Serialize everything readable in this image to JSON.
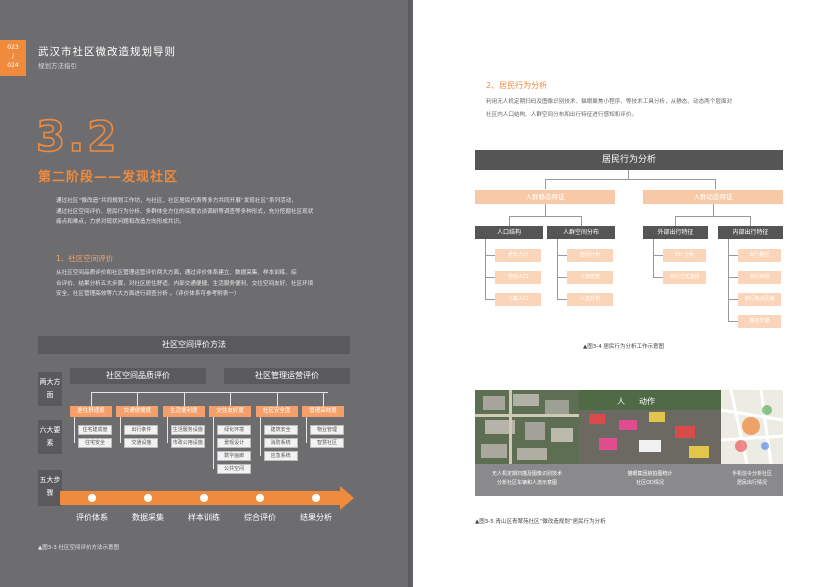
{
  "header": {
    "page_numbers": [
      "023",
      "/",
      "024"
    ],
    "title": "武汉市社区微改造规划导则",
    "subtitle": "规划方法指引"
  },
  "section": {
    "number": "3.2",
    "stage_title": "第二阶段——发现社区",
    "intro": [
      "通过社区“微改造”共同规划工作坊，与社区、社区居民代表等多方共同开展“发现社区”系列活动，",
      "通过社区空间评价、居民行为分析、多群体全方位的深度访谈调研等调查等多种形式，充分挖掘社区现状",
      "痛点和难点，力求对现状问题和改造方向形成共识。"
    ],
    "sub1_title": "1、社区空间评价",
    "sub1_text": [
      "从社区空间品质评价和社区管理运营评价两大方面，通过评价体系建立、数据采集、样本训练、综",
      "合评价、结果分析五大步骤，对社区居住舒适、内部交通便捷、生活服务便利、交往空间友好、社区环境",
      "安全、社区管理高效等六大方面进行调查分析 。（评价体系可参考附表一）"
    ]
  },
  "left_diagram": {
    "title": "社区空间评价方法",
    "row_labels": [
      "两大方面",
      "六大要素",
      "五大步骤"
    ],
    "aspects": [
      "社区空间品质评价",
      "社区管理运营评价"
    ],
    "elements": [
      "居住舒适度",
      "交通便捷度",
      "生活便利度",
      "交往友好度",
      "社区安全度",
      "管理高效度"
    ],
    "sub_items": [
      [
        "住宅建成度",
        "住宅安全"
      ],
      [
        "出行条件",
        "交通设施"
      ],
      [
        "生活服务设施",
        "市政公用设施"
      ],
      [
        "绿化环境",
        "景观设计",
        "数字画廊",
        "公共空间"
      ],
      [
        "建筑安全",
        "消防系统",
        "应急系统"
      ],
      [
        "物业管理",
        "智慧社区"
      ]
    ],
    "steps": [
      "评价体系",
      "数据采集",
      "样本训练",
      "综合评价",
      "结果分析"
    ],
    "caption": "▲图3-3 社区空间评价方法示意图"
  },
  "behavior": {
    "title": "2、居民行为分析",
    "text": [
      "利用无人机定期扫码及图像识别技术、猫眼聚焦小程序、等技术工具分析，从静态、动态两个层面对",
      "社区内人口结构、人群空间分布和出行特征进行感知和评价。"
    ],
    "diagram": {
      "root": "居民行为分析",
      "branches": [
        "人群静态特征",
        "人群动态特征"
      ],
      "groups": [
        "人口结构",
        "人群空间分布",
        "外部出行特征",
        "内部出行特征"
      ],
      "group_items": [
        [
          "老年人口",
          "劳动人口",
          "儿童人口"
        ],
        [
          "空间分布",
          "人流密度",
          "人流分布"
        ],
        [
          "OD 分析",
          "出行方式选择"
        ],
        [
          "出行路径",
          "出行目的",
          "出行热点区域",
          "静态交通"
        ]
      ],
      "caption": "▲图3-4 居民行为分析工作示意图"
    },
    "photos": {
      "labels": [
        "人",
        "动作"
      ],
      "captions": [
        [
          "无人机定期扫描及图像识别技术",
          "分析社区车辆和人流示意图"
        ],
        [
          "猫眼集团航拍图统计",
          "社区OD情况"
        ],
        [
          "手机信令分析社区",
          "居民出行情况"
        ]
      ],
      "figure_caption": "▲图3-5 青山区青翠苑社区“微改造规划”居民行为分析"
    }
  },
  "colors": {
    "accent": "#f08a3c",
    "left_bg": "#6d6d70",
    "box_orange": "#f5a06a",
    "dark_box": "#555555"
  }
}
